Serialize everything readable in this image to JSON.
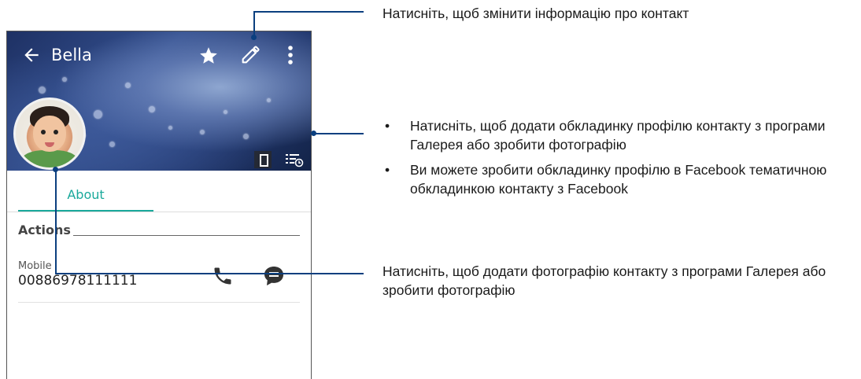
{
  "contact": {
    "name": "Bella",
    "tab_about": "About",
    "actions_label": "Actions",
    "mobile_label": "Mobile",
    "mobile_number": "00886978111111"
  },
  "icons": {
    "back": "arrow-left-icon",
    "favorite": "star-icon",
    "edit": "pencil-icon",
    "more": "more-vert-icon",
    "cover_toggle": "phone-outline-icon",
    "timeline": "timeline-icon",
    "call": "phone-icon",
    "message": "message-icon"
  },
  "colors": {
    "accent": "#1aa99b",
    "callout_line": "#0b3f7f"
  },
  "callouts": {
    "edit": "Натисніть, щоб змінити інформацію про контакт",
    "cover_bullets": [
      "Натисніть, щоб додати обкладинку профілю контакту з програми Галерея або зробити фотографію",
      "Ви можете зробити обкладинку профілю в Facebook тематичною обкладинкою контакту з Facebook"
    ],
    "photo": "Натисніть, щоб додати фотографію контакту з програми Галерея або зробити фотографію"
  }
}
